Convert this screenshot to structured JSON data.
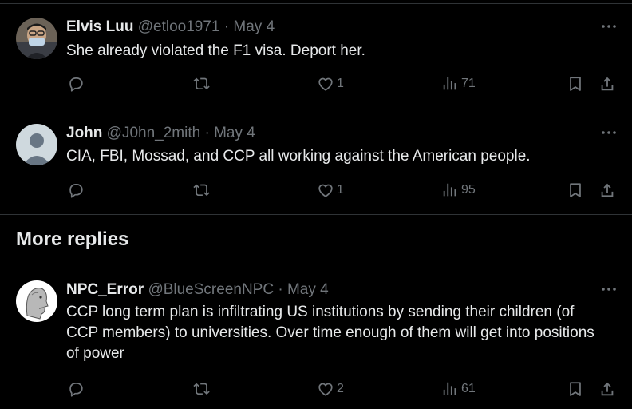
{
  "tweets": [
    {
      "name": "Elvis Luu",
      "handle": "@etloo1971",
      "dot": "·",
      "date": "May 4",
      "text": "She already violated the F1 visa. Deport her.",
      "likes": "1",
      "views": "71",
      "avatar_icon": "person-photo-avatar"
    },
    {
      "name": "John",
      "handle": "@J0hn_2mith",
      "dot": "·",
      "date": "May 4",
      "text": "CIA, FBI, Mossad, and CCP all working against the American people.",
      "likes": "1",
      "views": "95",
      "avatar_icon": "default-avatar"
    },
    {
      "name": "NPC_Error",
      "handle": "@BlueScreenNPC",
      "dot": "·",
      "date": "May 4",
      "text": "CCP long term plan is infiltrating US institutions by sending their children (of CCP members) to universities. Over time enough of them will get into positions of power",
      "likes": "2",
      "views": "61",
      "avatar_icon": "npc-avatar"
    }
  ],
  "more_replies_label": "More replies",
  "colors": {
    "background": "#000000",
    "text": "#e7e9ea",
    "muted": "#71767b",
    "divider": "#2f3336"
  }
}
